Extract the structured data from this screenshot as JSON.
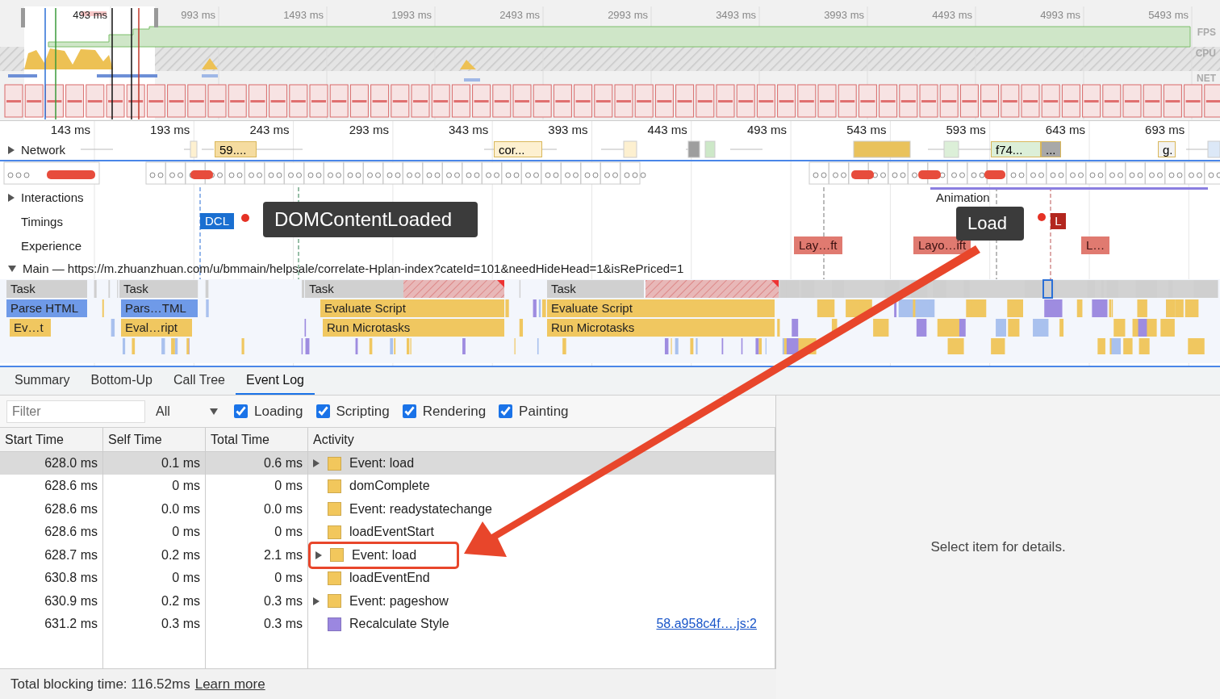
{
  "overview": {
    "ticks": [
      "493 ms",
      "993 ms",
      "1493 ms",
      "1993 ms",
      "2493 ms",
      "2993 ms",
      "3493 ms",
      "3993 ms",
      "4493 ms",
      "4993 ms",
      "5493 ms"
    ],
    "track_labels": [
      "FPS",
      "CPU",
      "NET"
    ]
  },
  "ruler": {
    "ticks": [
      "143 ms",
      "193 ms",
      "243 ms",
      "293 ms",
      "343 ms",
      "393 ms",
      "443 ms",
      "493 ms",
      "543 ms",
      "593 ms",
      "643 ms",
      "693 ms"
    ]
  },
  "tracks": [
    {
      "label": "Network",
      "kind": "collapsible",
      "expanded": false
    },
    {
      "label": "Interactions",
      "kind": "collapsible",
      "expanded": false
    },
    {
      "label": "Timings",
      "kind": "plain"
    },
    {
      "label": "Experience",
      "kind": "plain"
    }
  ],
  "network_requests": [
    "59....",
    "cor...",
    "f74...",
    "...",
    "g."
  ],
  "interactions": {
    "label": "Animation"
  },
  "timings": [
    {
      "label": "DCL",
      "color": "#1a6fd1"
    },
    {
      "label": "L",
      "color": "#b3261e"
    }
  ],
  "tooltips": [
    "DOMContentLoaded",
    "Load"
  ],
  "experience": [
    "Lay…ft",
    "Layo…ift",
    "L…"
  ],
  "main": {
    "label": "Main — https://m.zhuanzhuan.com/u/bmmain/helpsale/correlate-Hplan-index?cateId=101&needHideHead=1&isRePriced=1",
    "expanded": true
  },
  "flame_rows": [
    [
      "Task",
      "Task",
      "Task",
      "Task"
    ],
    [
      "Parse HTML",
      "Pars…TML",
      "Evaluate Script",
      "Evaluate Script"
    ],
    [
      "Ev…t",
      "Eval…ript",
      "Run Microtasks",
      "Run Microtasks"
    ]
  ],
  "tabs": [
    {
      "label": "Summary",
      "selected": false
    },
    {
      "label": "Bottom-Up",
      "selected": false
    },
    {
      "label": "Call Tree",
      "selected": false
    },
    {
      "label": "Event Log",
      "selected": true
    }
  ],
  "filter": {
    "placeholder": "Filter",
    "select": "All",
    "categories": [
      {
        "label": "Loading",
        "checked": true
      },
      {
        "label": "Scripting",
        "checked": true
      },
      {
        "label": "Rendering",
        "checked": true
      },
      {
        "label": "Painting",
        "checked": true
      }
    ]
  },
  "table": {
    "columns": [
      "Start Time",
      "Self Time",
      "Total Time",
      "Activity"
    ],
    "rows": [
      {
        "start": "628.0 ms",
        "self": "0.1 ms",
        "total": "0.6 ms",
        "activity": "Event: load",
        "color": "#f2c75c",
        "expandable": true,
        "selected": true,
        "annotated": false
      },
      {
        "start": "628.6 ms",
        "self": "0 ms",
        "total": "0 ms",
        "activity": "domComplete",
        "color": "#f2c75c",
        "expandable": false,
        "selected": false,
        "annotated": false
      },
      {
        "start": "628.6 ms",
        "self": "0.0 ms",
        "total": "0.0 ms",
        "activity": "Event: readystatechange",
        "color": "#f2c75c",
        "expandable": false,
        "selected": false,
        "annotated": false
      },
      {
        "start": "628.6 ms",
        "self": "0 ms",
        "total": "0 ms",
        "activity": "loadEventStart",
        "color": "#f2c75c",
        "expandable": false,
        "selected": false,
        "annotated": false
      },
      {
        "start": "628.7 ms",
        "self": "0.2 ms",
        "total": "2.1 ms",
        "activity": "Event: load",
        "color": "#f2c75c",
        "expandable": true,
        "selected": false,
        "annotated": true
      },
      {
        "start": "630.8 ms",
        "self": "0 ms",
        "total": "0 ms",
        "activity": "loadEventEnd",
        "color": "#f2c75c",
        "expandable": false,
        "selected": false,
        "annotated": false
      },
      {
        "start": "630.9 ms",
        "self": "0.2 ms",
        "total": "0.3 ms",
        "activity": "Event: pageshow",
        "color": "#f2c75c",
        "expandable": true,
        "selected": false,
        "annotated": false
      },
      {
        "start": "631.2 ms",
        "self": "0.3 ms",
        "total": "0.3 ms",
        "activity": "Recalculate Style",
        "color": "#9b87e0",
        "expandable": false,
        "selected": false,
        "annotated": false,
        "link": "58.a958c4f….js:2"
      }
    ]
  },
  "details": {
    "empty_message": "Select item for details."
  },
  "status_bar": {
    "text": "Total blocking time: 116.52ms",
    "link": "Learn more"
  }
}
